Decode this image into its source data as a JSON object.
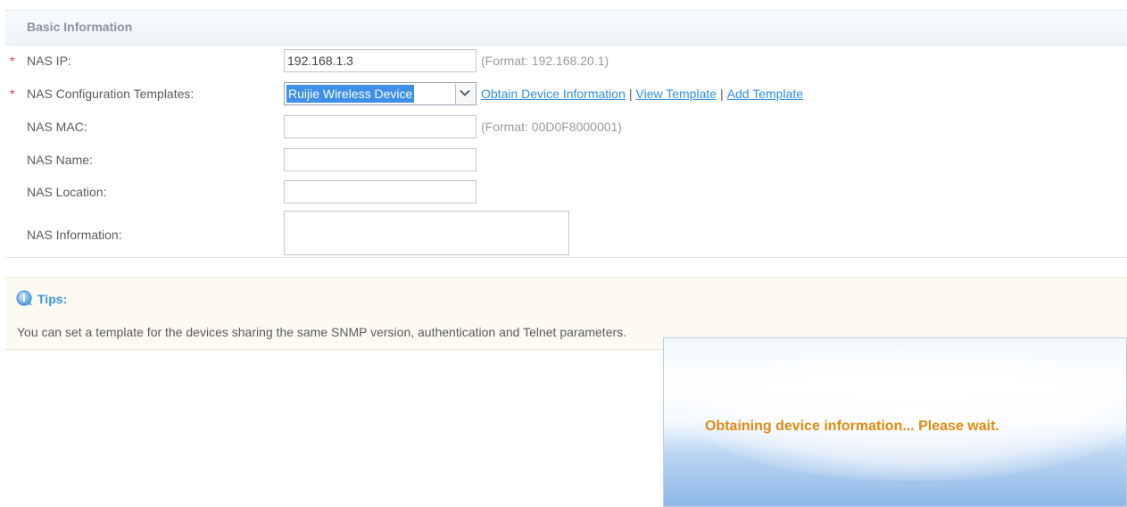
{
  "section": {
    "title": "Basic Information"
  },
  "form": {
    "nas_ip": {
      "required_mark": "*",
      "label": "NAS IP:",
      "value": "192.168.1.3",
      "hint": "(Format: 192.168.20.1)"
    },
    "templates": {
      "required_mark": "*",
      "label": "NAS Configuration Templates:",
      "selected": "Ruijie Wireless Device",
      "links": {
        "obtain": "Obtain Device Information",
        "separator": "|",
        "view": "View Template",
        "add": "Add Template"
      }
    },
    "nas_mac": {
      "label": "NAS MAC:",
      "value": "",
      "hint": "(Format: 00D0F8000001)"
    },
    "nas_name": {
      "label": "NAS Name:",
      "value": ""
    },
    "nas_location": {
      "label": "NAS Location:",
      "value": ""
    },
    "nas_information": {
      "label": "NAS Information:",
      "value": ""
    }
  },
  "tips": {
    "icon": "info-icon",
    "title": "Tips:",
    "text": "You can set a template for the devices sharing the same SNMP version, authentication and Telnet parameters."
  },
  "overlay": {
    "message": "Obtaining device information... Please wait."
  },
  "colors": {
    "required": "#e23b3b",
    "link": "#2e8fe0",
    "overlay_text": "#e08a12",
    "selection": "#3d8fe8"
  }
}
